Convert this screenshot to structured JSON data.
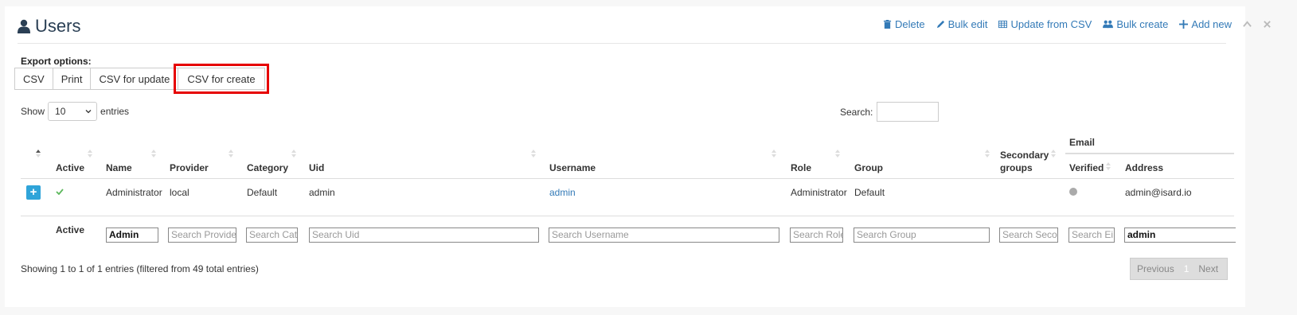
{
  "page": {
    "title": "Users"
  },
  "toolbar": {
    "delete": "Delete",
    "bulk_edit": "Bulk edit",
    "update_csv": "Update from CSV",
    "bulk_create": "Bulk create",
    "add_new": "Add new"
  },
  "export": {
    "label": "Export options:",
    "buttons": [
      "CSV",
      "Print",
      "CSV for update",
      "CSV for create"
    ]
  },
  "length": {
    "show": "Show",
    "value": "10",
    "entries": "entries"
  },
  "search": {
    "label": "Search:"
  },
  "table": {
    "group_header": "Email",
    "headers": {
      "active": "Active",
      "name": "Name",
      "provider": "Provider",
      "category": "Category",
      "uid": "Uid",
      "username": "Username",
      "role": "Role",
      "group": "Group",
      "secondary_1": "Secondary",
      "secondary_2": "groups",
      "verified": "Verified",
      "address": "Address"
    },
    "row": {
      "expand": "+",
      "active_icon": "check-icon",
      "name": "Administrator",
      "provider": "local",
      "category": "Default",
      "uid": "admin",
      "username": "admin",
      "role": "Administrator",
      "group": "Default",
      "verified_color": "#aaaaaa",
      "address": "admin@isard.io"
    },
    "footer": {
      "active": "Active"
    },
    "filters": {
      "name": {
        "value": "Admin",
        "placeholder": ""
      },
      "provider": {
        "value": "",
        "placeholder": "Search Provide"
      },
      "category": {
        "value": "",
        "placeholder": "Search Cat"
      },
      "uid": {
        "value": "",
        "placeholder": "Search Uid"
      },
      "username": {
        "value": "",
        "placeholder": "Search Username"
      },
      "role": {
        "value": "",
        "placeholder": "Search Role"
      },
      "group": {
        "value": "",
        "placeholder": "Search Group"
      },
      "secondary": {
        "value": "",
        "placeholder": "Search Seco"
      },
      "verified": {
        "value": "",
        "placeholder": "Search Ei"
      },
      "address": {
        "value": "admin",
        "placeholder": ""
      }
    }
  },
  "info": "Showing 1 to 1 of 1 entries (filtered from 49 total entries)",
  "pagination": {
    "previous": "Previous",
    "current": "1",
    "next": "Next"
  }
}
